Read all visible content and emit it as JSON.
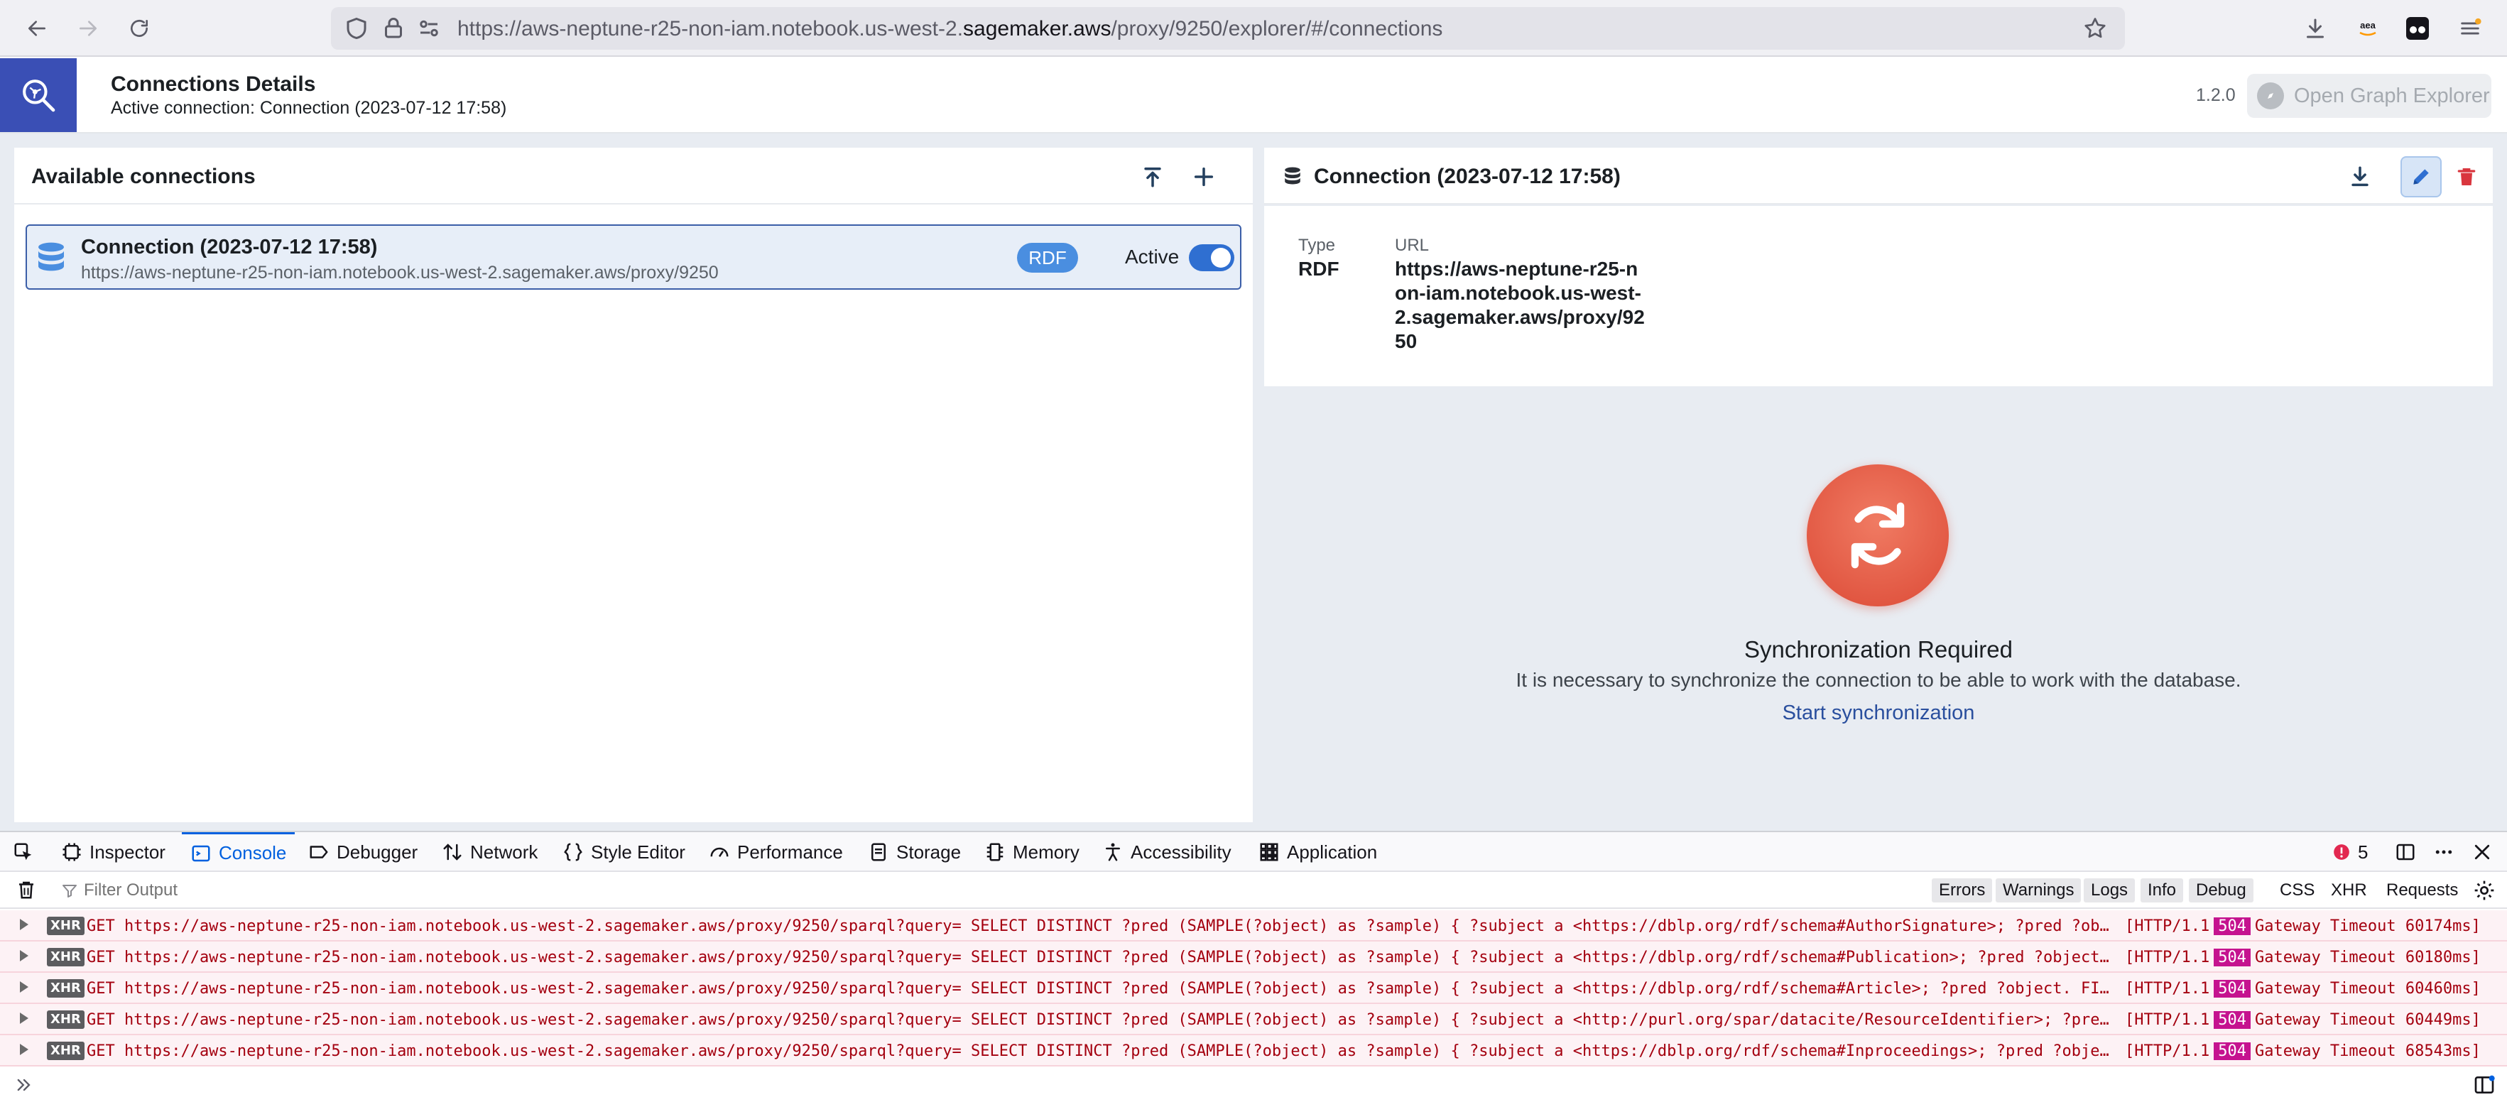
{
  "browser": {
    "url_prefix": "https://aws-neptune-r25-non-iam.notebook.us-west-2.",
    "url_host": "sagemaker.aws",
    "url_suffix": "/proxy/9250/explorer/#/connections"
  },
  "header": {
    "title": "Connections Details",
    "subtitle": "Active connection: Connection (2023-07-12 17:58)",
    "version": "1.2.0",
    "open_button": "Open Graph Explorer"
  },
  "left_panel": {
    "title": "Available connections",
    "connections": [
      {
        "name": "Connection (2023-07-12 17:58)",
        "url": "https://aws-neptune-r25-non-iam.notebook.us-west-2.sagemaker.aws/proxy/9250",
        "type_badge": "RDF",
        "status_label": "Active",
        "active": true
      }
    ]
  },
  "right_panel": {
    "title": "Connection (2023-07-12 17:58)",
    "type_label": "Type",
    "url_label": "URL",
    "type_value": "RDF",
    "url_value_lines": [
      "https://aws-neptune-r25-n",
      "on-iam.notebook.us-west-",
      "2.sagemaker.aws/proxy/92",
      "50"
    ],
    "sync_title": "Synchronization Required",
    "sync_description": "It is necessary to synchronize the connection to be able to work with the database.",
    "sync_link": "Start synchronization"
  },
  "devtools": {
    "tabs": [
      "Inspector",
      "Console",
      "Debugger",
      "Network",
      "Style Editor",
      "Performance",
      "Storage",
      "Memory",
      "Accessibility",
      "Application"
    ],
    "active_tab": "Console",
    "error_count": "5",
    "filter_placeholder": "Filter Output",
    "levels": [
      "Errors",
      "Warnings",
      "Logs",
      "Info",
      "Debug"
    ],
    "extra_filters": [
      "CSS",
      "XHR",
      "Requests"
    ],
    "logs": [
      {
        "badge": "XHR",
        "message": "GET https://aws-neptune-r25-non-iam.notebook.us-west-2.sagemaker.aws/proxy/9250/sparql?query= SELECT DISTINCT ?pred (SAMPLE(?object) as ?sample) { ?subject a <https://dblp.org/rdf/schema#AuthorSignature>; ?pred ?ob…",
        "proto": "[HTTP/1.1",
        "code": "504",
        "status": "Gateway Timeout 60174ms]"
      },
      {
        "badge": "XHR",
        "message": "GET https://aws-neptune-r25-non-iam.notebook.us-west-2.sagemaker.aws/proxy/9250/sparql?query= SELECT DISTINCT ?pred (SAMPLE(?object) as ?sample) { ?subject a <https://dblp.org/rdf/schema#Publication>; ?pred ?object…",
        "proto": "[HTTP/1.1",
        "code": "504",
        "status": "Gateway Timeout 60180ms]"
      },
      {
        "badge": "XHR",
        "message": "GET https://aws-neptune-r25-non-iam.notebook.us-west-2.sagemaker.aws/proxy/9250/sparql?query= SELECT DISTINCT ?pred (SAMPLE(?object) as ?sample) { ?subject a <https://dblp.org/rdf/schema#Article>; ?pred ?object. FI…",
        "proto": "[HTTP/1.1",
        "code": "504",
        "status": "Gateway Timeout 60460ms]"
      },
      {
        "badge": "XHR",
        "message": "GET https://aws-neptune-r25-non-iam.notebook.us-west-2.sagemaker.aws/proxy/9250/sparql?query= SELECT DISTINCT ?pred (SAMPLE(?object) as ?sample) { ?subject a <http://purl.org/spar/datacite/ResourceIdentifier>; ?pre…",
        "proto": "[HTTP/1.1",
        "code": "504",
        "status": "Gateway Timeout 60449ms]"
      },
      {
        "badge": "XHR",
        "message": "GET https://aws-neptune-r25-non-iam.notebook.us-west-2.sagemaker.aws/proxy/9250/sparql?query= SELECT DISTINCT ?pred (SAMPLE(?object) as ?sample) { ?subject a <https://dblp.org/rdf/schema#Inproceedings>; ?pred ?obje…",
        "proto": "[HTTP/1.1",
        "code": "504",
        "status": "Gateway Timeout 68543ms]"
      }
    ]
  },
  "colors": {
    "brand": "#3a4fb5",
    "badge": "#4a8ee0",
    "sync": "#dc4a36",
    "link": "#2a4f9e",
    "error_text": "#a4000f"
  }
}
